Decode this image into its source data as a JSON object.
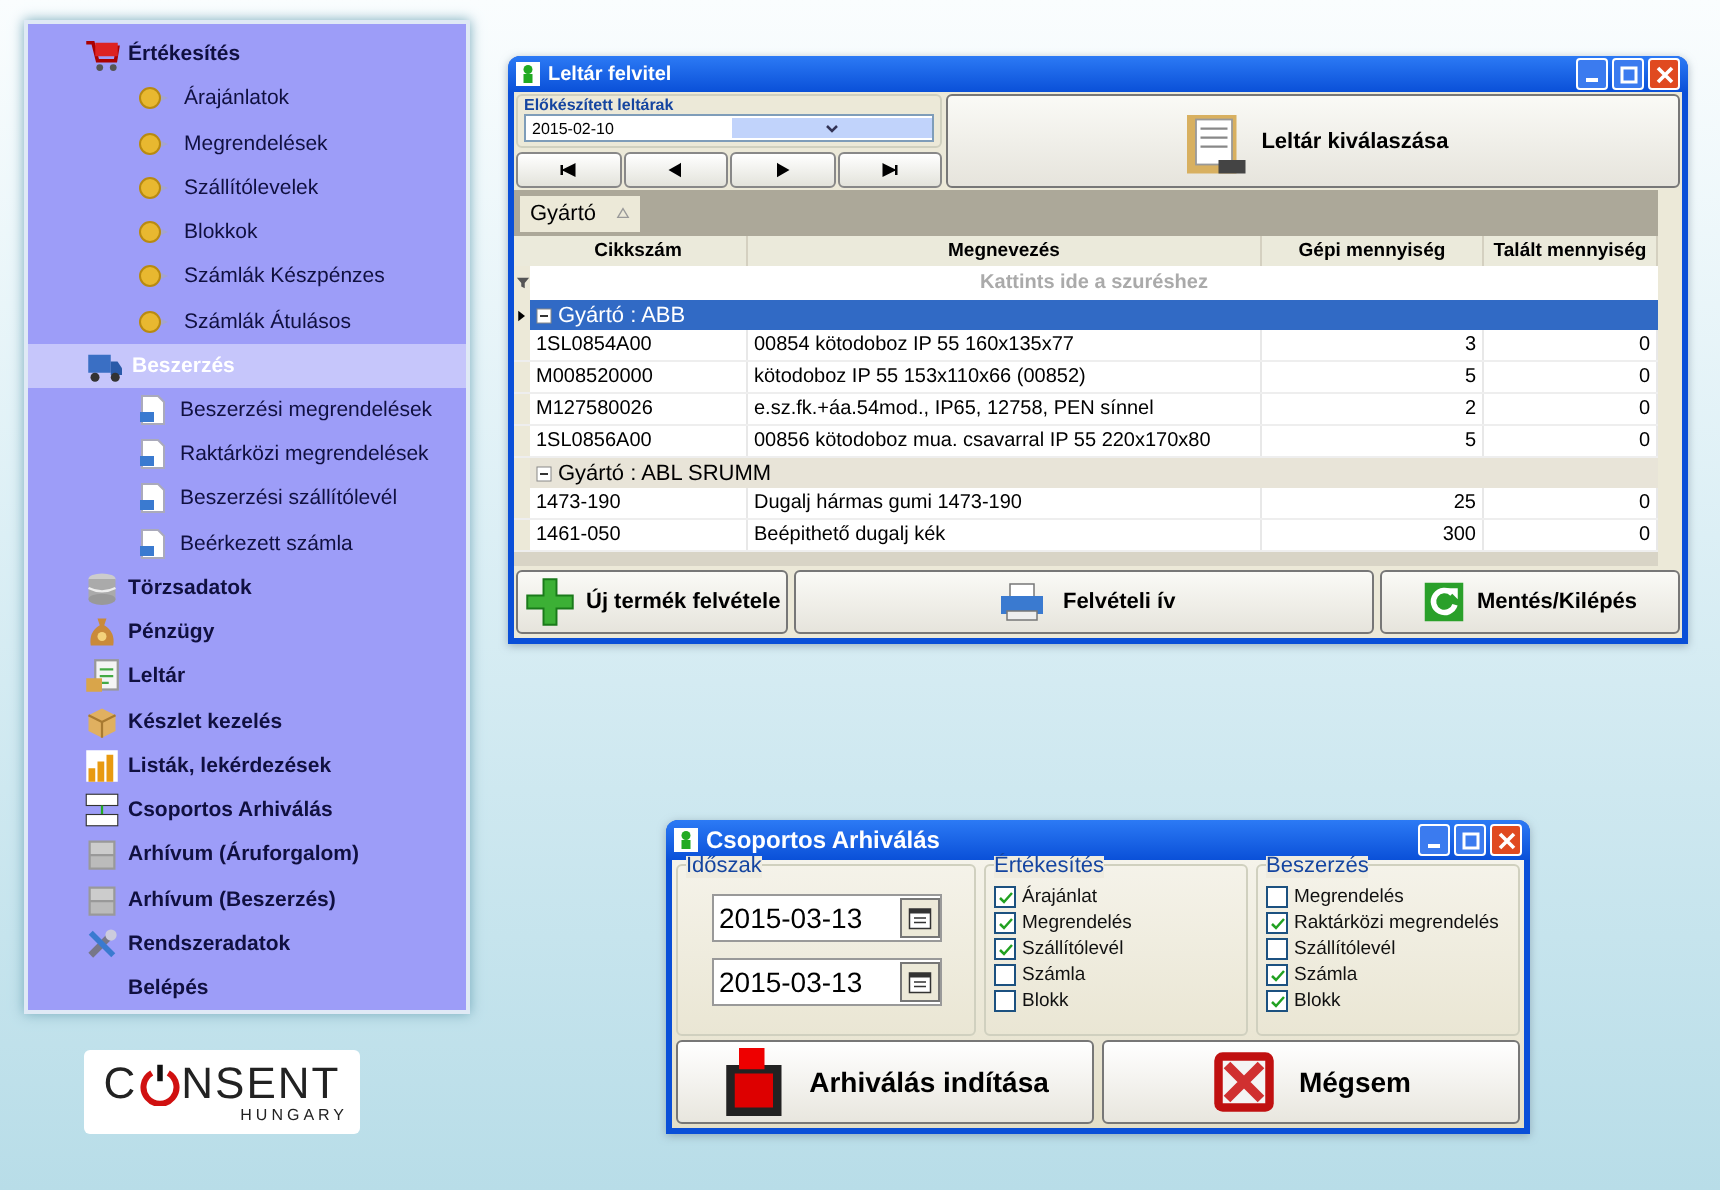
{
  "sidebar": {
    "items": [
      {
        "label": "Értékesítés",
        "selected": false,
        "children": [
          {
            "label": "Árajánlatok",
            "selected": false
          },
          {
            "label": "Megrendelések",
            "selected": false
          },
          {
            "label": "Szállítólevelek",
            "selected": false
          },
          {
            "label": "Blokkok",
            "selected": false
          },
          {
            "label": "Számlák Készpénzes",
            "selected": false
          },
          {
            "label": "Számlák Átulásos",
            "selected": false
          }
        ]
      },
      {
        "label": "Beszerzés",
        "selected": true,
        "children": [
          {
            "label": "Beszerzési megrendelések",
            "selected": false
          },
          {
            "label": "Raktárközi megrendelések",
            "selected": false
          },
          {
            "label": "Beszerzési szállítólevél",
            "selected": false
          },
          {
            "label": "Beérkezett számla",
            "selected": false
          }
        ]
      },
      {
        "label": "Törzsadatok",
        "selected": false
      },
      {
        "label": "Pénzügy",
        "selected": false
      },
      {
        "label": "Leltár",
        "selected": false
      },
      {
        "label": "Készlet kezelés",
        "selected": false
      },
      {
        "label": "Listák, lekérdezések",
        "selected": false
      },
      {
        "label": "Csoportos Arhiválás",
        "selected": false
      },
      {
        "label": "Arhívum (Áruforgalom)",
        "selected": false
      },
      {
        "label": "Arhívum (Beszerzés)",
        "selected": false
      },
      {
        "label": "Rendszeradatok",
        "selected": false
      },
      {
        "label": "Belépés",
        "selected": false
      }
    ]
  },
  "logo": {
    "first_letter": "C",
    "rest": "NSENT",
    "tagline": "HUNGARY"
  },
  "inventory_window": {
    "title": "Leltár felvitel",
    "prepared_label": "Előkészített leltárak",
    "prepared_value": "2015-02-10",
    "select_button": "Leltár kiválaszása",
    "group_by": "Gyártó",
    "columns": [
      "Cikkszám",
      "Megnevezés",
      "Gépi mennyiség",
      "Talált mennyiség"
    ],
    "filter_hint": "Kattints ide a szuréshez",
    "groups": [
      {
        "label": "Gyártó : ABB",
        "selected": true,
        "expanded": true,
        "rows": [
          {
            "cells": [
              "1SL0854A00",
              "00854 kötodoboz IP 55 160x135x77",
              "3",
              "0"
            ]
          },
          {
            "cells": [
              "M008520000",
              "kötodoboz IP 55 153x110x66 (00852)",
              "5",
              "0"
            ]
          },
          {
            "cells": [
              "M127580026",
              "e.sz.fk.+áa.54mod., IP65, 12758, PEN sínnel",
              "2",
              "0"
            ]
          },
          {
            "cells": [
              "1SL0856A00",
              "00856 kötodoboz mua. csavarral IP 55 220x170x80",
              "5",
              "0"
            ]
          }
        ]
      },
      {
        "label": "Gyártó : ABL SRUMM",
        "selected": false,
        "expanded": true,
        "rows": [
          {
            "cells": [
              "1473-190",
              "Dugalj hármas gumi 1473-190",
              "25",
              "0"
            ]
          },
          {
            "cells": [
              "1461-050",
              "Beépithető dugalj kék",
              "300",
              "0"
            ]
          }
        ]
      }
    ],
    "buttons": [
      "Új termék felvétele",
      "Felvételi ív",
      "Mentés/Kilépés"
    ]
  },
  "archive_dialog": {
    "title": "Csoportos Arhiválás",
    "period": {
      "label": "Időszak",
      "from": "2015-03-13",
      "to": "2015-03-13"
    },
    "sections": [
      {
        "label": "Értékesítés",
        "options": [
          {
            "label": "Árajánlat",
            "checked": true
          },
          {
            "label": "Megrendelés",
            "checked": true
          },
          {
            "label": "Szállítólevél",
            "checked": true
          },
          {
            "label": "Számla",
            "checked": false
          },
          {
            "label": "Blokk",
            "checked": false
          }
        ]
      },
      {
        "label": "Beszerzés",
        "options": [
          {
            "label": "Megrendelés",
            "checked": false
          },
          {
            "label": "Raktárközi megrendelés",
            "checked": true
          },
          {
            "label": "Szállítólevél",
            "checked": false
          },
          {
            "label": "Számla",
            "checked": true
          },
          {
            "label": "Blokk",
            "checked": true
          }
        ]
      }
    ],
    "buttons": [
      "Arhiválás indítása",
      "Mégsem"
    ]
  }
}
